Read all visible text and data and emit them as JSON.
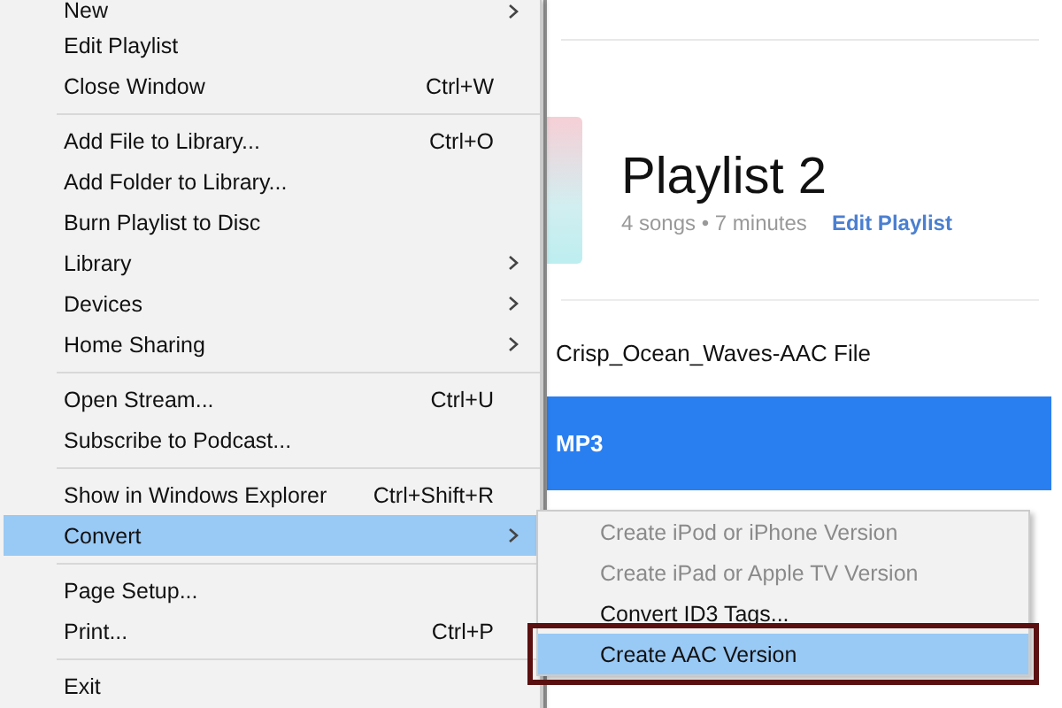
{
  "menu": {
    "items": [
      {
        "kind": "item",
        "label": "New",
        "submenu": true,
        "selected": false
      },
      {
        "kind": "item",
        "label": "Edit Playlist",
        "submenu": false,
        "selected": false
      },
      {
        "kind": "item",
        "label": "Close Window",
        "shortcut": "Ctrl+W",
        "submenu": false,
        "selected": false
      },
      {
        "kind": "separator"
      },
      {
        "kind": "item",
        "label": "Add File to Library...",
        "shortcut": "Ctrl+O",
        "submenu": false,
        "selected": false
      },
      {
        "kind": "item",
        "label": "Add Folder to Library...",
        "submenu": false,
        "selected": false
      },
      {
        "kind": "item",
        "label": "Burn Playlist to Disc",
        "submenu": false,
        "selected": false
      },
      {
        "kind": "item",
        "label": "Library",
        "submenu": true,
        "selected": false
      },
      {
        "kind": "item",
        "label": "Devices",
        "submenu": true,
        "selected": false
      },
      {
        "kind": "item",
        "label": "Home Sharing",
        "submenu": true,
        "selected": false
      },
      {
        "kind": "separator"
      },
      {
        "kind": "item",
        "label": "Open Stream...",
        "shortcut": "Ctrl+U",
        "submenu": false,
        "selected": false
      },
      {
        "kind": "item",
        "label": "Subscribe to Podcast...",
        "submenu": false,
        "selected": false
      },
      {
        "kind": "separator"
      },
      {
        "kind": "item",
        "label": "Show in Windows Explorer",
        "shortcut": "Ctrl+Shift+R",
        "submenu": false,
        "selected": false
      },
      {
        "kind": "item",
        "label": "Convert",
        "submenu": true,
        "selected": true
      },
      {
        "kind": "separator"
      },
      {
        "kind": "item",
        "label": "Page Setup...",
        "submenu": false,
        "selected": false
      },
      {
        "kind": "item",
        "label": "Print...",
        "shortcut": "Ctrl+P",
        "submenu": false,
        "selected": false
      },
      {
        "kind": "separator"
      },
      {
        "kind": "item",
        "label": "Exit",
        "submenu": false,
        "selected": false
      }
    ]
  },
  "submenu": {
    "items": [
      {
        "label": "Create iPod or iPhone Version",
        "disabled": true,
        "selected": false
      },
      {
        "label": "Create iPad or Apple TV Version",
        "disabled": true,
        "selected": false
      },
      {
        "label": "Convert ID3 Tags...",
        "disabled": false,
        "selected": false
      },
      {
        "label": "Create AAC Version",
        "disabled": false,
        "selected": true
      }
    ]
  },
  "playlist": {
    "title": "Playlist 2",
    "summary": "4 songs • 7 minutes",
    "edit_link": "Edit Playlist"
  },
  "tracks": [
    {
      "title": "Crisp_Ocean_Waves-AAC File",
      "selected": false
    },
    {
      "title": "MP3",
      "selected": true
    }
  ]
}
